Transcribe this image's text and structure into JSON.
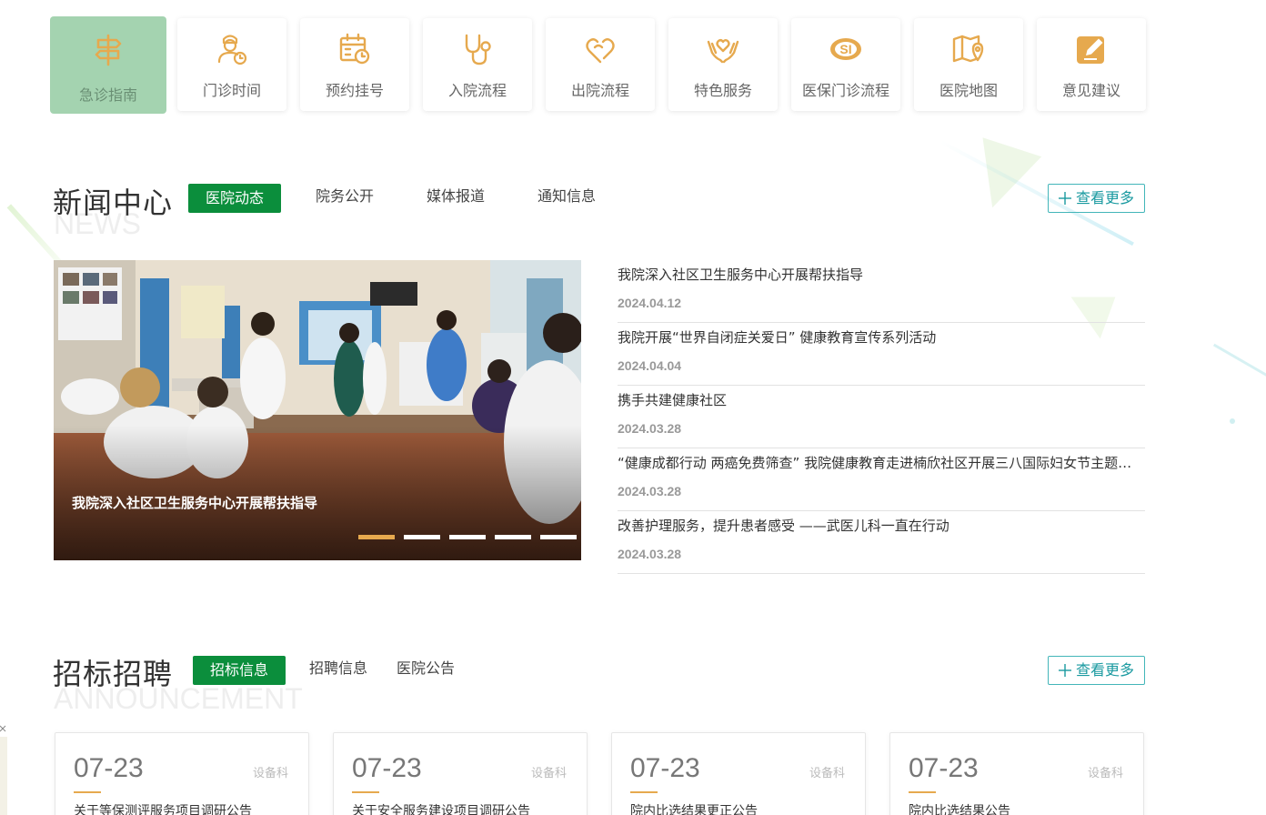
{
  "quick_links": [
    {
      "label": "急诊指南",
      "icon": "signpost-icon",
      "active": true
    },
    {
      "label": "门诊时间",
      "icon": "doctor-clock-icon",
      "active": false
    },
    {
      "label": "预约挂号",
      "icon": "calendar-clock-icon",
      "active": false
    },
    {
      "label": "入院流程",
      "icon": "stethoscope-icon",
      "active": false
    },
    {
      "label": "出院流程",
      "icon": "heart-hands-icon",
      "active": false
    },
    {
      "label": "特色服务",
      "icon": "care-heart-icon",
      "active": false
    },
    {
      "label": "医保门诊流程",
      "icon": "medical-insurance-icon",
      "active": false
    },
    {
      "label": "医院地图",
      "icon": "map-icon",
      "active": false
    },
    {
      "label": "意见建议",
      "icon": "edit-icon",
      "active": false
    }
  ],
  "news": {
    "title": "新闻中心",
    "title_en": "NEWS",
    "tabs": [
      "医院动态",
      "院务公开",
      "媒体报道",
      "通知信息"
    ],
    "more_label": "查看更多",
    "slider_caption": "我院深入社区卫生服务中心开展帮扶指导",
    "slider_dots": 5,
    "slider_active": 0,
    "items": [
      {
        "title": "我院深入社区卫生服务中心开展帮扶指导",
        "date": "2024.04.12"
      },
      {
        "title": "我院开展“世界自闭症关爱日” 健康教育宣传系列活动",
        "date": "2024.04.04"
      },
      {
        "title": "携手共建健康社区",
        "date": "2024.03.28"
      },
      {
        "title": "“健康成都行动 两癌免费筛查” 我院健康教育走进楠欣社区开展三八国际妇女节主题活动",
        "date": "2024.03.28"
      },
      {
        "title": "改善护理服务，提升患者感受 ——武医儿科一直在行动",
        "date": "2024.03.28"
      }
    ]
  },
  "announcement": {
    "title": "招标招聘",
    "title_en": "ANNOUNCEMENT",
    "tabs": [
      "招标信息",
      "招聘信息",
      "医院公告"
    ],
    "more_label": "查看更多",
    "cards": [
      {
        "date": "07-23",
        "dept": "设备科",
        "title": "关于等保测评服务项目调研公告"
      },
      {
        "date": "07-23",
        "dept": "设备科",
        "title": "关于安全服务建设项目调研公告"
      },
      {
        "date": "07-23",
        "dept": "设备科",
        "title": "院内比选结果更正公告"
      },
      {
        "date": "07-23",
        "dept": "设备科",
        "title": "院内比选结果公告"
      }
    ]
  },
  "colors": {
    "primary_green": "#0b8e3c",
    "active_tile": "#a4d3b0",
    "icon_orange": "#e6a94e",
    "teal": "#1a9aa0"
  }
}
